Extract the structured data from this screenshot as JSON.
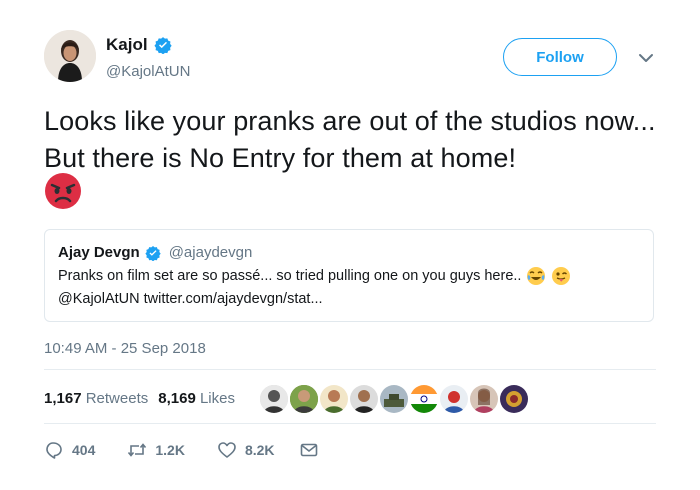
{
  "author": {
    "name": "Kajol",
    "handle": "@KajolAtUN"
  },
  "follow_label": "Follow",
  "tweet": {
    "text": "Looks like your pranks are out of the studios now... But there is No Entry for them at home!"
  },
  "quoted": {
    "name": "Ajay Devgn",
    "handle": "@ajaydevgn",
    "line1": "Pranks on film set are so passé... so tried pulling one on you guys here..",
    "line2": "@KajolAtUN twitter.com/ajaydevgn/stat..."
  },
  "timestamp": "10:49 AM - 25 Sep 2018",
  "stats": {
    "retweets_count": "1,167",
    "retweets_label": "Retweets",
    "likes_count": "8,169",
    "likes_label": "Likes"
  },
  "actions": {
    "replies": "404",
    "retweets": "1.2K",
    "likes": "8.2K"
  },
  "colors": {
    "accent": "#1da1f2",
    "secondary_text": "#657786",
    "divider": "#e6ecf0"
  }
}
